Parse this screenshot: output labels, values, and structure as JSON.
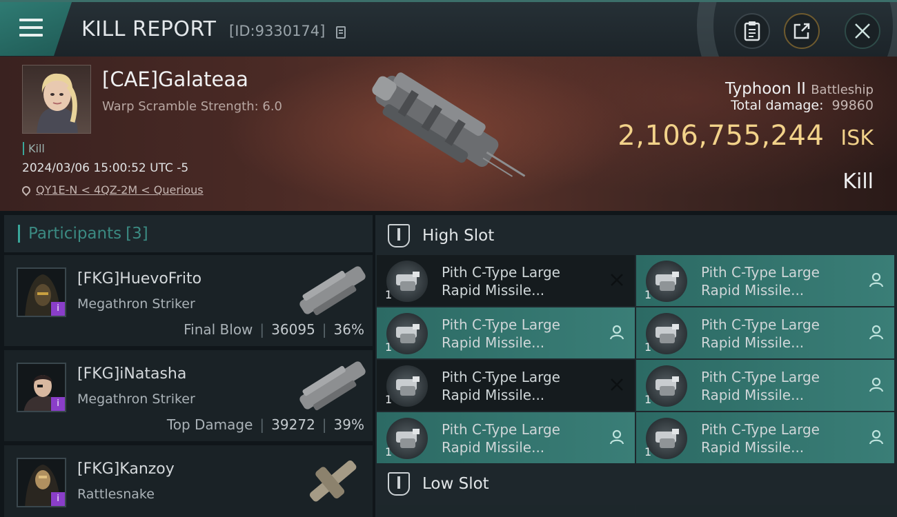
{
  "header": {
    "title": "KILL REPORT",
    "report_id": "[ID:9330174]"
  },
  "banner": {
    "pilot_name": "[CAE]Galateaa",
    "scramble": "Warp Scramble Strength: 6.0",
    "kill_tag": "Kill",
    "timestamp": "2024/03/06 15:00:52 UTC -5",
    "location": "QY1E-N < 4QZ-2M < Querious",
    "ship_name": "Typhoon II",
    "ship_class": "Battleship",
    "total_damage_label": "Total damage:",
    "total_damage": "99860",
    "isk_value": "2,106,755,244",
    "isk_unit": "ISK",
    "result": "Kill"
  },
  "participants": {
    "title": "Participants",
    "count": "[3]",
    "items": [
      {
        "name": "[FKG]HuevoFrito",
        "ship": "Megathron Striker",
        "label": "Final Blow",
        "damage": "36095",
        "percent": "36%"
      },
      {
        "name": "[FKG]iNatasha",
        "ship": "Megathron Striker",
        "label": "Top Damage",
        "damage": "39272",
        "percent": "39%"
      },
      {
        "name": "[FKG]Kanzoy",
        "ship": "Rattlesnake"
      }
    ]
  },
  "slots": {
    "high_title": "High Slot",
    "low_title": "Low Slot",
    "modules": [
      {
        "qty": "1",
        "line1": "Pith C-Type Large",
        "line2": "Rapid Missile...",
        "state": "destroyed"
      },
      {
        "qty": "1",
        "line1": "Pith C-Type Large",
        "line2": "Rapid Missile...",
        "state": "dropped"
      },
      {
        "qty": "1",
        "line1": "Pith C-Type Large",
        "line2": "Rapid Missile...",
        "state": "dropped"
      },
      {
        "qty": "1",
        "line1": "Pith C-Type Large",
        "line2": "Rapid Missile...",
        "state": "dropped"
      },
      {
        "qty": "1",
        "line1": "Pith C-Type Large",
        "line2": "Rapid Missile...",
        "state": "destroyed"
      },
      {
        "qty": "1",
        "line1": "Pith C-Type Large",
        "line2": "Rapid Missile...",
        "state": "dropped"
      },
      {
        "qty": "1",
        "line1": "Pith C-Type Large",
        "line2": "Rapid Missile...",
        "state": "dropped"
      },
      {
        "qty": "1",
        "line1": "Pith C-Type Large",
        "line2": "Rapid Missile...",
        "state": "dropped"
      }
    ]
  },
  "colors": {
    "accent_teal": "#3aa79a",
    "isk_gold": "#f2d28a",
    "badge_purple": "#8a3ec9"
  }
}
